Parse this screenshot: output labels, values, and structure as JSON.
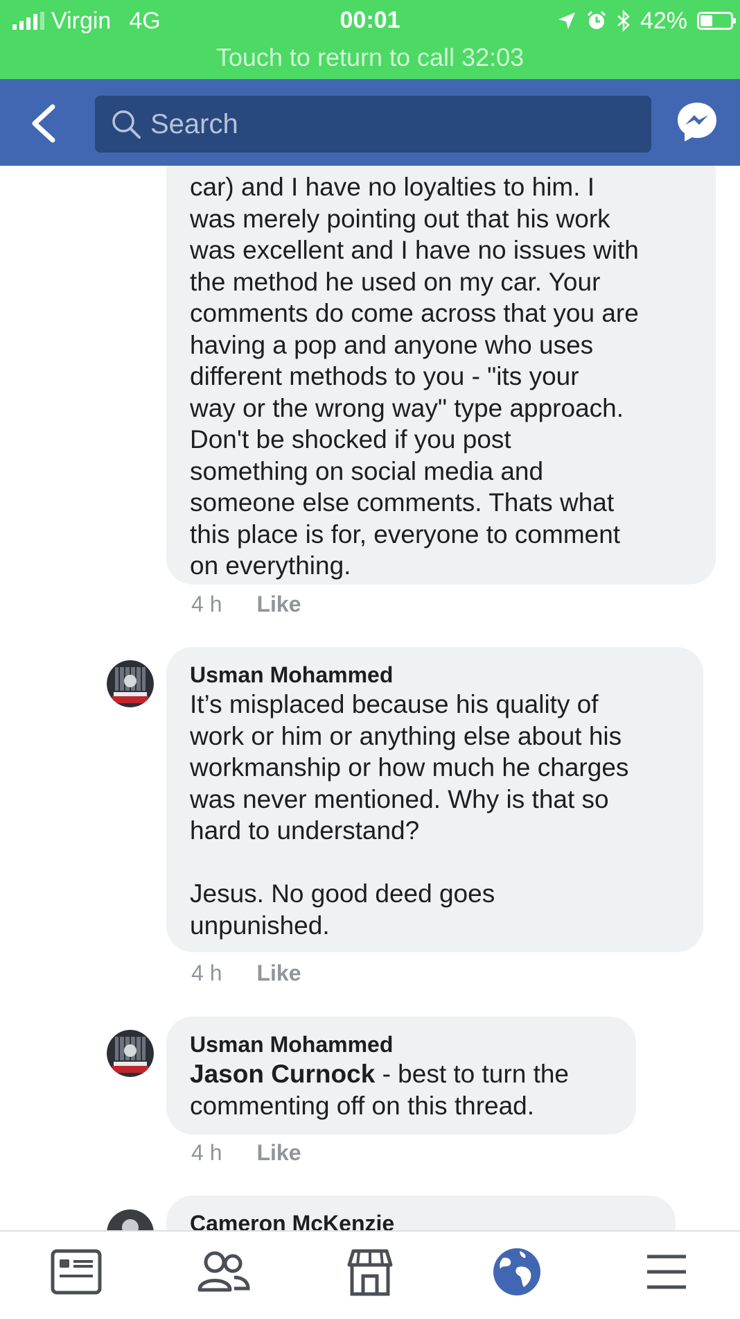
{
  "status_bar": {
    "carrier": "Virgin",
    "network": "4G",
    "time": "00:01",
    "battery": "42%",
    "battery_level": 0.42,
    "return_to_call": "Touch to return to call 32:03",
    "icons": [
      "signal-icon",
      "location-icon",
      "alarm-icon",
      "bluetooth-icon",
      "battery-icon"
    ]
  },
  "nav": {
    "search_placeholder": "Search",
    "icons": [
      "back-icon",
      "search-icon",
      "messenger-icon"
    ]
  },
  "comments": [
    {
      "text": "car) and I have no loyalties to him. I\nwas merely pointing out that his work\nwas excellent and I have no issues with\nthe method he used on my car. Your\ncomments do come across that you are\nhaving a pop and anyone who uses\ndifferent methods to you - \"its your\nway or the wrong way\" type approach.\nDon't be shocked if you post\nsomething on social media and\nsomeone else comments. Thats what\nthis place is for, everyone to comment\non everything.",
      "time": "4 h",
      "like": "Like"
    },
    {
      "author": "Usman Mohammed",
      "text": "It’s misplaced because his quality of\nwork or him or anything else about his\nworkmanship or how much he charges\nwas never mentioned. Why is that so\nhard to understand?\n\nJesus. No good deed goes\nunpunished.",
      "time": "4 h",
      "like": "Like"
    },
    {
      "author": "Usman Mohammed",
      "mention": "Jason Curnock",
      "text": " - best to turn the\ncommenting off on this thread.",
      "time": "4 h",
      "like": "Like"
    },
    {
      "author": "Cameron McKenzie"
    }
  ],
  "tab_bar": {
    "tabs": [
      "news-feed-icon",
      "friends-icon",
      "marketplace-icon",
      "globe-icon",
      "menu-icon"
    ],
    "active_tab": "globe-icon",
    "active_color": "#4267b2",
    "inactive_color": "#4b4f56"
  },
  "colors": {
    "status_green": "#4cd964",
    "fb_blue": "#4267b2",
    "search_bg": "#29487d",
    "bubble_bg": "#f0f1f3"
  }
}
